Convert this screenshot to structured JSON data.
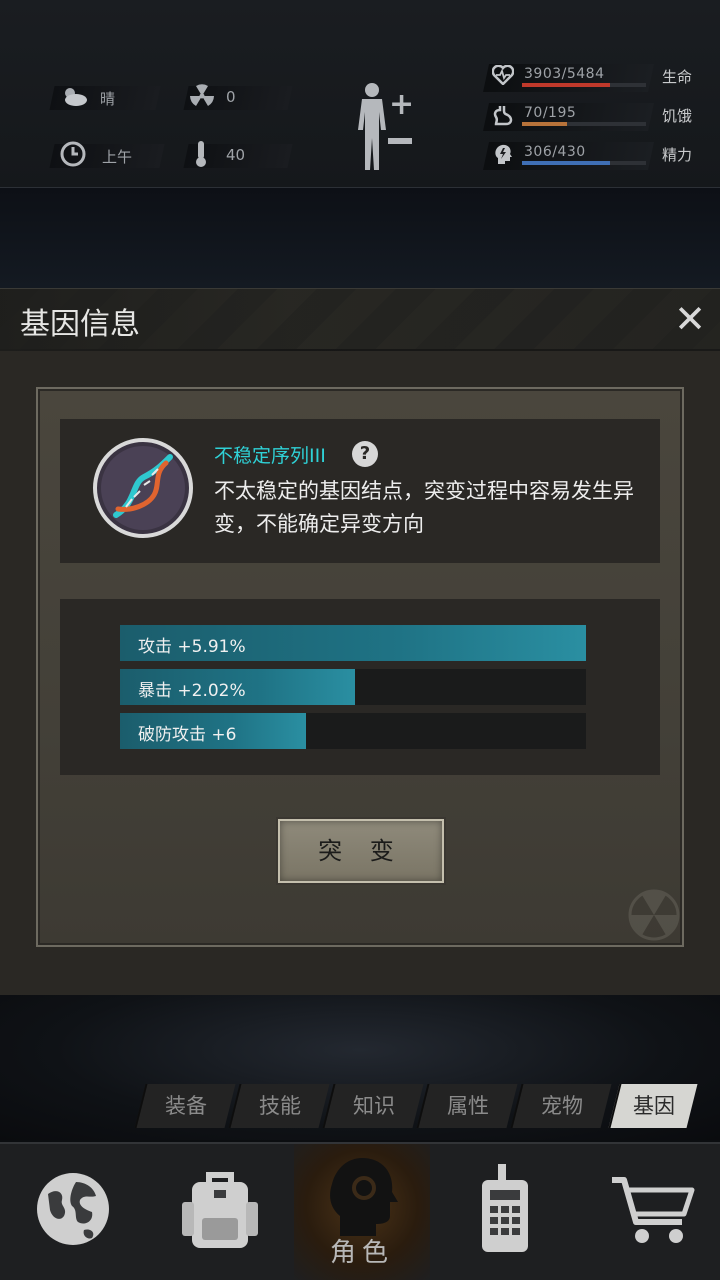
{
  "hud": {
    "weather": {
      "icon": "cloud-sun-icon",
      "value": "晴"
    },
    "radiation": {
      "icon": "radiation-icon",
      "value": "0"
    },
    "time": {
      "icon": "clock-icon",
      "value": "上午"
    },
    "temperature": {
      "icon": "thermometer-icon",
      "value": "40"
    },
    "stats": [
      {
        "icon": "heart-icon",
        "value": "3903/5484",
        "label": "生命",
        "ratio": 0.712,
        "color": "#c0392b"
      },
      {
        "icon": "stomach-icon",
        "value": "70/195",
        "label": "饥饿",
        "ratio": 0.359,
        "color": "#b8733a"
      },
      {
        "icon": "energy-icon",
        "value": "306/430",
        "label": "精力",
        "ratio": 0.712,
        "color": "#3f6fb5"
      }
    ]
  },
  "modal": {
    "title": "基因信息",
    "gene": {
      "name": "不稳定序列III",
      "description": "不太稳定的基因结点，突变过程中容易发生异变，不能确定异变方向"
    },
    "bonuses": [
      {
        "label": "攻击 +5.91%",
        "ratio": 1.0
      },
      {
        "label": "暴击 +2.02%",
        "ratio": 0.505
      },
      {
        "label": "破防攻击 +6",
        "ratio": 0.4
      }
    ],
    "mutate_button": "突 变"
  },
  "tabs": [
    "装备",
    "技能",
    "知识",
    "属性",
    "宠物",
    "基因"
  ],
  "active_tab": "基因",
  "nav": [
    {
      "icon": "globe-icon",
      "label": ""
    },
    {
      "icon": "backpack-icon",
      "label": ""
    },
    {
      "icon": "character-head-icon",
      "label": "角色"
    },
    {
      "icon": "walkie-talkie-icon",
      "label": ""
    },
    {
      "icon": "shopping-cart-icon",
      "label": ""
    }
  ]
}
